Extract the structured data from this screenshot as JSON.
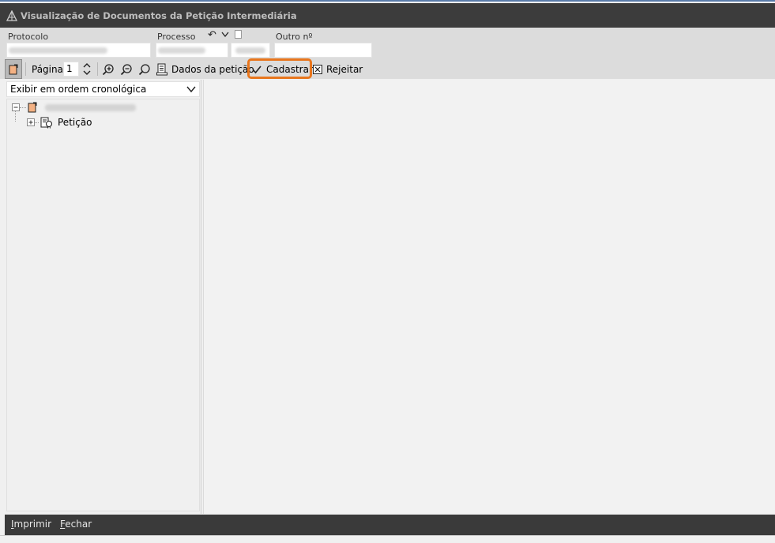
{
  "window": {
    "title": "Visualização de Documentos da Petição Intermediária"
  },
  "fields": {
    "protocolo_label": "Protocolo",
    "processo_label": "Processo",
    "outro_label": "Outro nº",
    "outro_value": ""
  },
  "toolbar": {
    "pagina_label": "Página",
    "pagina_value": "1",
    "dados_label": "Dados da petição",
    "cadastrar_label": "Cadastrar",
    "rejeitar_label": "Rejeitar"
  },
  "left_panel": {
    "order_select_value": "Exibir em ordem cronológica",
    "tree": {
      "child_label": "Petição"
    }
  },
  "bottom_bar": {
    "imprimir_first": "I",
    "imprimir_rest": "mprimir",
    "fechar_first": "F",
    "fechar_rest": "echar"
  },
  "colors": {
    "titlebar": "#3c3c3c",
    "highlight": "#e8761d",
    "panel": "#f0f0f0",
    "bottom_bar": "#3a3a3a"
  }
}
